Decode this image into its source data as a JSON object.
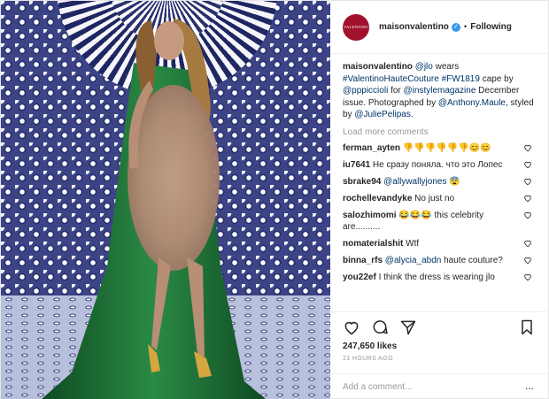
{
  "header": {
    "avatar_text": "VALENTINO",
    "username": "maisonvalentino",
    "separator": "•",
    "follow_label": "Following"
  },
  "caption": {
    "username": "maisonvalentino",
    "parts": [
      "@jlo",
      "wears",
      "#ValentinoHauteCouture",
      "#FW1819",
      "cape by",
      "@pppiccioli",
      "for",
      "@instylemagazine",
      "December issue. Photographed by",
      "@Anthony.Maule",
      ", styled by",
      "@JuliePelipas",
      "."
    ]
  },
  "load_more_label": "Load more comments",
  "comments": [
    {
      "user": "ferman_ayten",
      "text": "👎👎👎👎👎👎😊😊"
    },
    {
      "user": "iu7641",
      "text": "Не сразу поняла. что это Лопес"
    },
    {
      "user": "sbrake94",
      "mention": "@allywallyjones",
      "text": " 😨"
    },
    {
      "user": "rochellevandyke",
      "text": "No just no"
    },
    {
      "user": "salozhimomi",
      "text": "😂😂😂 this celebrity are.........."
    },
    {
      "user": "nomaterialshit",
      "text": "Wtf"
    },
    {
      "user": "binna_rfs",
      "mention": "@alycia_abdn",
      "text": " haute couture?"
    },
    {
      "user": "you22ef",
      "text": "I think the dress is wearing jlo"
    }
  ],
  "likes_label": "247,650 likes",
  "time_label": "21 HOURS AGO",
  "add_comment_placeholder": "Add a comment...",
  "more_options": "...",
  "icons": {
    "heart": "heart-icon",
    "comment": "comment-icon",
    "share": "share-icon",
    "save": "bookmark-icon",
    "verified": "verified-badge-icon"
  },
  "colors": {
    "brand": "#a2112c",
    "verified": "#3897f0",
    "link": "#003569",
    "muted": "#999999",
    "gown": "#1f6b33"
  }
}
